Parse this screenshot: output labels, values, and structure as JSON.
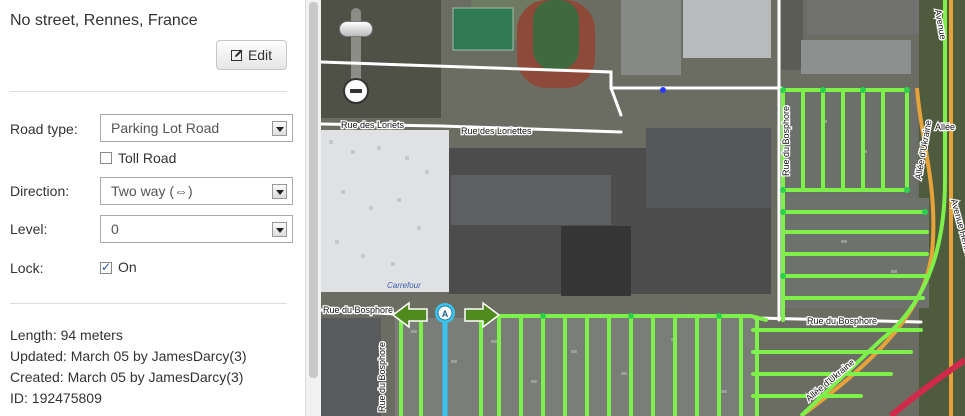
{
  "panel": {
    "address": "No street, Rennes, France",
    "edit_label": "Edit",
    "road_type": {
      "label": "Road type:",
      "value": "Parking Lot Road"
    },
    "toll_road": {
      "label": "Toll Road",
      "checked": false
    },
    "direction": {
      "label": "Direction:",
      "value": "Two way (⇔)"
    },
    "level": {
      "label": "Level:",
      "value": "0"
    },
    "lock": {
      "label": "Lock:",
      "value_label": "On",
      "checked": true
    },
    "length": "Length: 94 meters",
    "updated": "Updated: March 05 by JamesDarcy(3)",
    "created": "Created: March 05 by JamesDarcy(3)",
    "id": "ID: 192475809"
  },
  "map": {
    "street_labels": [
      "Rue des Loriets",
      "Rue des Loriettes",
      "Rue du Bosphore",
      "Rue du Bosphore",
      "Rue du Bosphore",
      "Rue du Bosphore",
      "Allée d'Ukraine",
      "Allée d'Ukraine",
      "Allée d'Ukraine",
      "Avenue",
      "Avenue Henri Fréville",
      "Allée"
    ],
    "store_label": "Carrefour",
    "node_marker": "A",
    "colors": {
      "selected_segment": "#3cc4f0",
      "parking_road": "#7df04a",
      "street": "#ffffff",
      "highway": "#e8a23a"
    }
  }
}
